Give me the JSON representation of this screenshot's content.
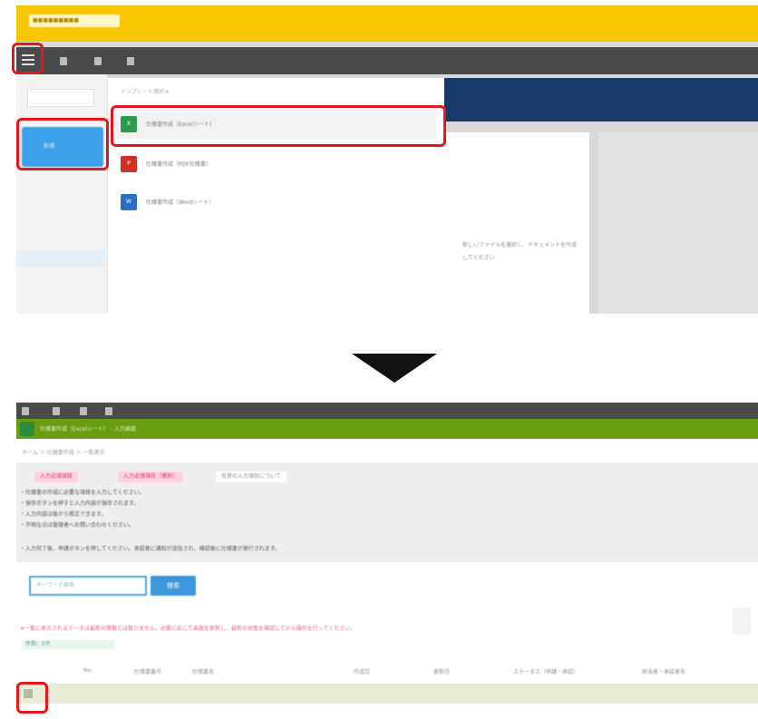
{
  "top_screenshot": {
    "logo_text": "■■■■■■■■■",
    "sidebar_new_button": "新規",
    "dropdown_header": "テンプレート選択 ▾",
    "dropdown_items": [
      {
        "label": "仕様書作成（Excelシート）",
        "icon": "excel-sheet-icon",
        "color": "#2e9a4e"
      },
      {
        "label": "仕様書作成（PDF仕様書）",
        "icon": "pdf-document-icon",
        "color": "#d0302a"
      },
      {
        "label": "仕様書作成（Wordシート）",
        "icon": "word-document-icon",
        "color": "#2b6cc4"
      }
    ],
    "doc_text": "新しいファイルを選択し、ドキュメントを作成してください"
  },
  "bottom_screenshot": {
    "title": "仕様書作成（Excelシート） - 入力画面",
    "breadcrumb": "ホーム ＞ 仕様書作成 ＞ 一覧表示",
    "tags": [
      "入力必須項目",
      "入力必須項目（選択）",
      "任意の入力項目について"
    ],
    "info_lines": [
      "・仕様書の作成に必要な項目を入力してください。",
      "・保存ボタンを押すと入力内容が保存されます。",
      "・入力内容は後から修正できます。",
      "・不明な点は管理者へお問い合わせください。",
      "・入力完了後、申請ボタンを押してください。承認者に通知が送信され、確認後に仕様書が発行されます。"
    ],
    "search_placeholder": "キーワード検索",
    "search_button": "検索",
    "warning": "※一覧に表示されるデータは最新の情報とは限りません。必要に応じて画面を更新し、最新の状態を確認してから操作を行ってください。",
    "count": "件数：0件",
    "table_headers": [
      "No.",
      "仕様書番号",
      "仕様書名",
      "作成日",
      "更新日",
      "ステータス（申請・承認）",
      "担当者・承認者名"
    ]
  },
  "colors": {
    "highlight": "#e8151b",
    "yellow_header": "#f7c600",
    "green_header": "#6a9c12",
    "blue_button": "#3ea0e8"
  }
}
